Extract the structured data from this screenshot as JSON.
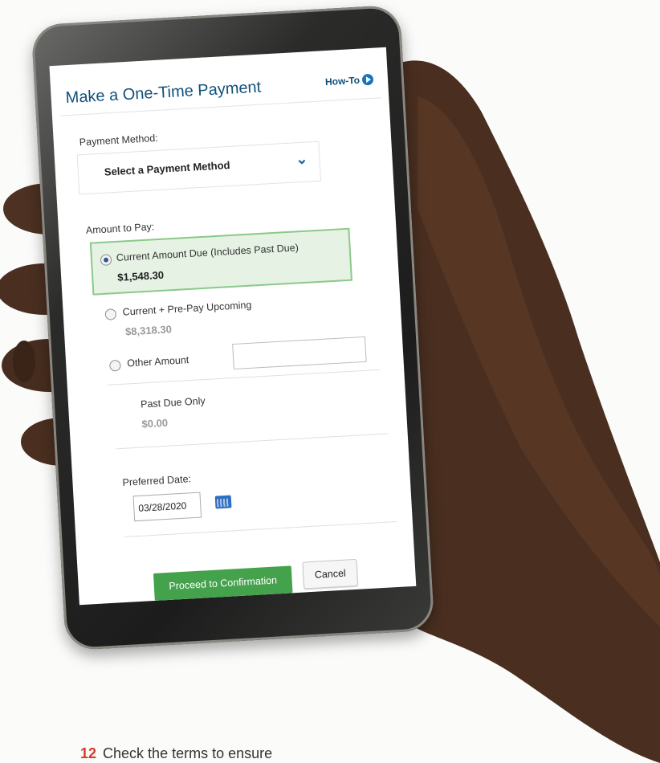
{
  "header": {
    "title": "Make a One-Time Payment",
    "howto_label": "How-To"
  },
  "payment_method": {
    "label": "Payment Method:",
    "selected": "Select a Payment Method"
  },
  "amount": {
    "label": "Amount to Pay:",
    "options": [
      {
        "label": "Current Amount Due (Includes Past Due)",
        "value": "$1,548.30",
        "selected": true
      },
      {
        "label": "Current + Pre-Pay Upcoming",
        "value": "$8,318.30",
        "selected": false
      },
      {
        "label": "Other Amount",
        "value": "",
        "selected": false
      }
    ],
    "past_due_label": "Past Due Only",
    "past_due_value": "$0.00"
  },
  "date": {
    "label": "Preferred Date:",
    "value": "03/28/2020"
  },
  "buttons": {
    "proceed": "Proceed to Confirmation",
    "cancel": "Cancel"
  },
  "caption": {
    "number": "12",
    "text": "Check the terms to ensure"
  },
  "colors": {
    "title": "#11507a",
    "selected_bg": "#e6f3e4",
    "proceed_bg": "#45a24c"
  }
}
